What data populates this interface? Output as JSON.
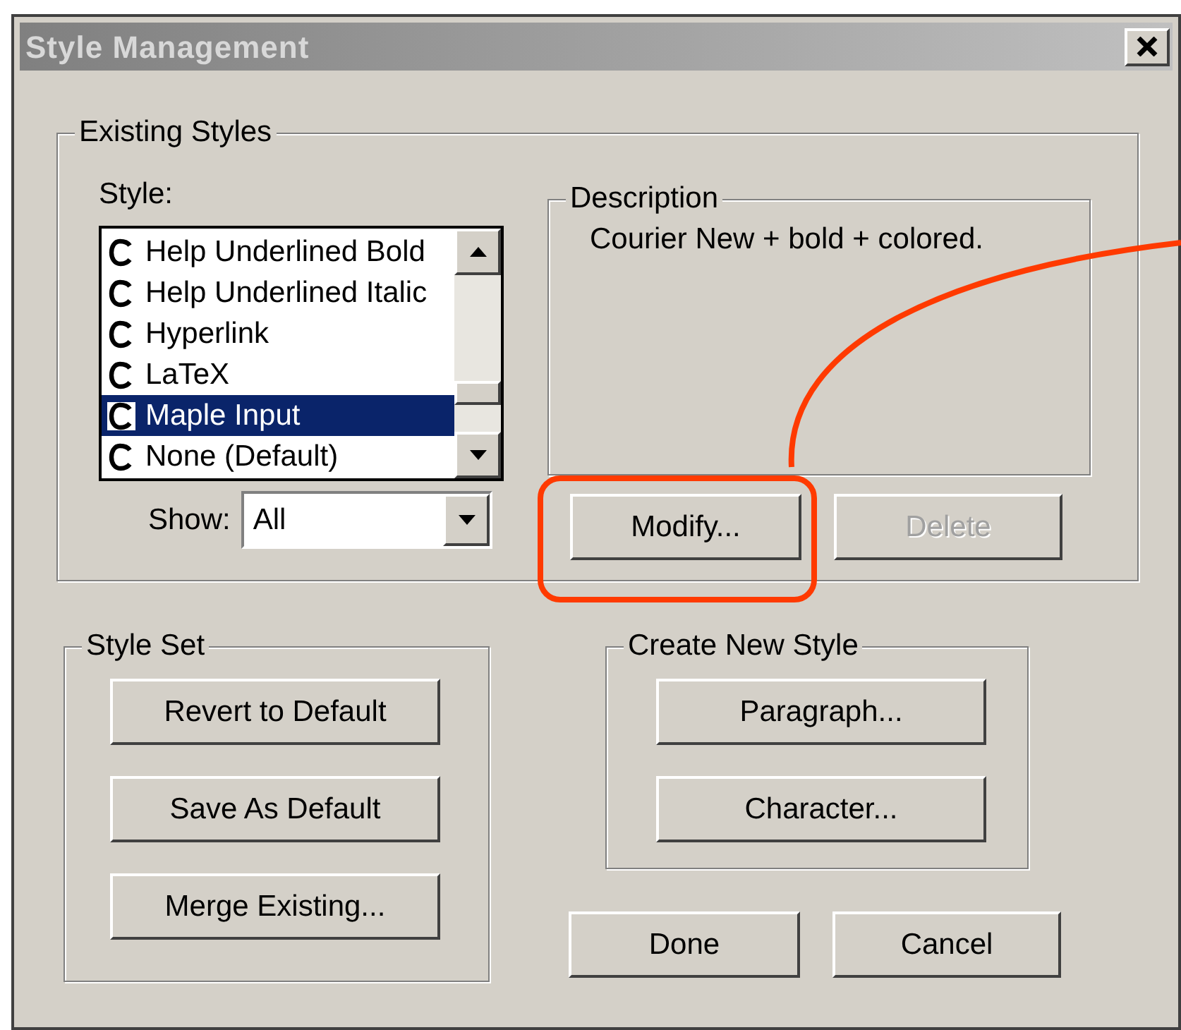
{
  "window": {
    "title": "Style Management"
  },
  "existing_styles": {
    "title": "Existing Styles",
    "style_label": "Style:",
    "styles": [
      {
        "label": "Help Underlined Bold",
        "selected": false
      },
      {
        "label": "Help Underlined Italic",
        "selected": false
      },
      {
        "label": "Hyperlink",
        "selected": false
      },
      {
        "label": "LaTeX",
        "selected": false
      },
      {
        "label": "Maple Input",
        "selected": true
      },
      {
        "label": "None (Default)",
        "selected": false
      }
    ],
    "show_label": "Show:",
    "show_value": "All",
    "description": {
      "title": "Description",
      "text": "Courier New + bold + colored."
    },
    "buttons": [
      {
        "label": "Modify...",
        "disabled": false,
        "highlighted": true
      },
      {
        "label": "Delete",
        "disabled": true,
        "highlighted": false
      }
    ]
  },
  "style_set": {
    "title": "Style Set",
    "buttons": [
      "Revert to Default",
      "Save As Default",
      "Merge Existing..."
    ]
  },
  "create_new_style": {
    "title": "Create New Style",
    "buttons": [
      "Paragraph...",
      "Character..."
    ]
  },
  "buttons": [
    "Done",
    "Cancel"
  ]
}
